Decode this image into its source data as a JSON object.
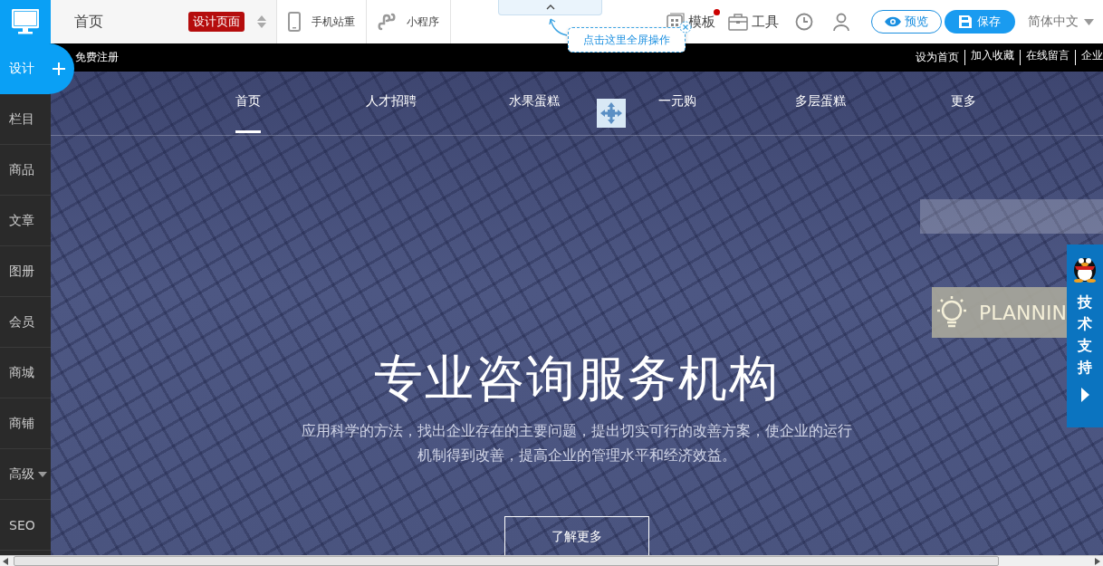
{
  "topbar": {
    "page_title": "首页",
    "page_badge": "设计页面",
    "mobile": "手机站重",
    "miniapp": "小程序",
    "template": "模板",
    "template_notice": true,
    "tools": "工具",
    "preview": "预览",
    "save": "保存",
    "language": "简体中文"
  },
  "fullscreen_tip": {
    "text": "点击这里全屏操作"
  },
  "sidebar": {
    "items": [
      {
        "label": "设计",
        "selected": true,
        "dropdown": false
      },
      {
        "label": "栏目",
        "selected": false,
        "dropdown": false
      },
      {
        "label": "商品",
        "selected": false,
        "dropdown": false
      },
      {
        "label": "文章",
        "selected": false,
        "dropdown": false
      },
      {
        "label": "图册",
        "selected": false,
        "dropdown": false
      },
      {
        "label": "会员",
        "selected": false,
        "dropdown": false
      },
      {
        "label": "商城",
        "selected": false,
        "dropdown": false
      },
      {
        "label": "商铺",
        "selected": false,
        "dropdown": false
      },
      {
        "label": "高级",
        "selected": false,
        "dropdown": true
      },
      {
        "label": "SEO",
        "selected": false,
        "dropdown": false
      }
    ]
  },
  "site_strip": {
    "register": "免费注册",
    "links": [
      "设为首页",
      "加入收藏",
      "在线留言",
      "企业"
    ]
  },
  "site_nav": [
    {
      "label": "首页",
      "selected": true
    },
    {
      "label": "人才招聘",
      "selected": false
    },
    {
      "label": "水果蛋糕",
      "selected": false
    },
    {
      "label": "一元购",
      "selected": false
    },
    {
      "label": "多层蛋糕",
      "selected": false
    },
    {
      "label": "更多",
      "selected": false
    }
  ],
  "hero": {
    "headline": "专业咨询服务机构",
    "description": "应用科学的方法，找出企业存在的主要问题，提出切实可行的改善方案，使企业的运行机制得到改善，提高企业的管理水平和经济效益。",
    "button": "了解更多",
    "planning": "PLANNIN"
  },
  "support": {
    "label": "技术支持"
  }
}
